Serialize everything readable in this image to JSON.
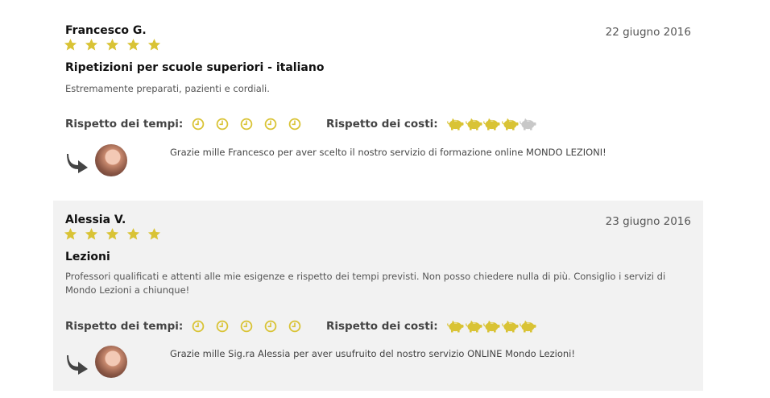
{
  "reviews": [
    {
      "author": "Francesco G.",
      "date": "22 giugno 2016",
      "stars": 5,
      "title": "Ripetizioni per scuole superiori - italiano",
      "comment": "Estremamente preparati, pazienti e cordiali.",
      "time_label": "Rispetto dei tempi:",
      "time_rating": 5,
      "cost_label": "Rispetto dei costi:",
      "cost_rating": 4,
      "reply": "Grazie mille Francesco per aver scelto il nostro servizio di formazione online MONDO LEZIONI!"
    },
    {
      "author": "Alessia V.",
      "date": "23 giugno 2016",
      "stars": 5,
      "title": "Lezioni",
      "comment": "Professori qualificati e attenti alle mie esigenze e rispetto dei tempi previsti. Non posso chiedere nulla di più. Consiglio i servizi di Mondo Lezioni a chiunque!",
      "time_label": "Rispetto dei tempi:",
      "time_rating": 5,
      "cost_label": "Rispetto dei costi:",
      "cost_rating": 5,
      "reply": "Grazie mille Sig.ra Alessia per aver usufruito del nostro servizio ONLINE Mondo Lezioni!"
    }
  ],
  "rating_max": 5,
  "colors": {
    "accent": "#d9c335",
    "inactive": "#c8c8c8",
    "alt_background": "#f2f2f2"
  },
  "icons": {
    "star": "star-icon",
    "clock": "clock-icon",
    "cost": "piggy-bank-icon",
    "reply": "reply-arrow-icon"
  }
}
